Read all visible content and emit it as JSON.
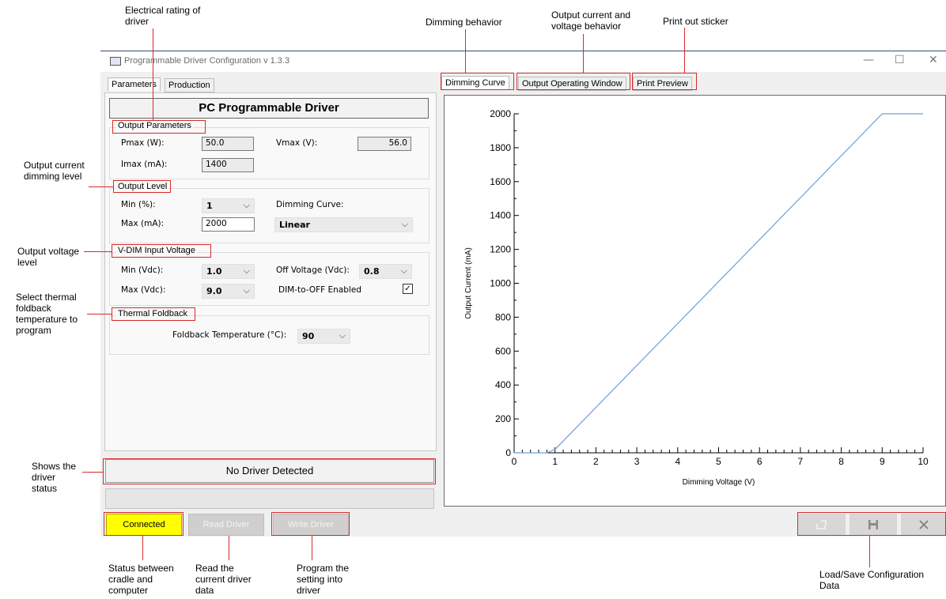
{
  "window": {
    "title": "Programmable Driver Configuration v 1.3.3",
    "minimize": "—",
    "maximize": "☐",
    "close": "✕"
  },
  "left_tabs": [
    "Parameters",
    "Production"
  ],
  "panel_title": "PC Programmable Driver",
  "output_parameters": {
    "title": "Output Parameters",
    "pmax_label": "Pmax (W):",
    "pmax_value": "50.0",
    "vmax_label": "Vmax (V):",
    "vmax_value": "56.0",
    "imax_label": "Imax (mA):",
    "imax_value": "1400"
  },
  "output_level": {
    "title": "Output Level",
    "min_label": "Min (%):",
    "min_value": "1",
    "max_label": "Max (mA):",
    "max_value": "2000",
    "curve_label": "Dimming Curve:",
    "curve_value": "Linear"
  },
  "vdim": {
    "title": "V-DIM Input Voltage",
    "min_label": "Min (Vdc):",
    "min_value": "1.0",
    "max_label": "Max (Vdc):",
    "max_value": "9.0",
    "off_label": "Off Voltage (Vdc):",
    "off_value": "0.8",
    "dim_off_label": "DIM-to-OFF Enabled",
    "dim_off_checked": true
  },
  "thermal": {
    "title": "Thermal Foldback",
    "temp_label": "Foldback Temperature (°C):",
    "temp_value": "90"
  },
  "status": "No Driver Detected",
  "buttons": {
    "connected": "Connected",
    "read": "Read Driver",
    "write": "Write Driver"
  },
  "right_tabs": [
    "Dimming Curve",
    "Output Operating Window",
    "Print Preview"
  ],
  "icons": {
    "load": "load-icon",
    "save": "save-icon",
    "clear": "clear-icon"
  },
  "annotations": {
    "electrical": "Electrical rating of driver",
    "dimming_behavior": "Dimming behavior",
    "output_window": "Output current and voltage behavior",
    "print": "Print out sticker",
    "output_level": "Output current dimming level",
    "voltage_level": "Output voltage level",
    "thermal": "Select thermal foldback temperature to program",
    "driver_status": "Shows the driver status",
    "status_conn": "Status between cradle and computer",
    "read": "Read the current driver data",
    "program": "Program the setting into driver",
    "load_save": "Load/Save Configuration Data"
  },
  "colors": {
    "line": "#6f9fd8",
    "connected_bg": "#ffff00",
    "annotation_box": "#d62b2b"
  },
  "chart_data": {
    "type": "line",
    "xlabel": "Dimming Voltage (V)",
    "ylabel": "Output Current (mA)",
    "xlim": [
      0,
      10
    ],
    "ylim": [
      0,
      2000
    ],
    "x_ticks": [
      0,
      1,
      2,
      3,
      4,
      5,
      6,
      7,
      8,
      9,
      10
    ],
    "y_ticks": [
      0,
      200,
      400,
      600,
      800,
      1000,
      1200,
      1400,
      1600,
      1800,
      2000
    ],
    "series": [
      {
        "x": [
          0,
          0.8,
          1.0,
          9.0,
          10.0
        ],
        "y": [
          0,
          0,
          20,
          2000,
          2000
        ]
      }
    ]
  }
}
